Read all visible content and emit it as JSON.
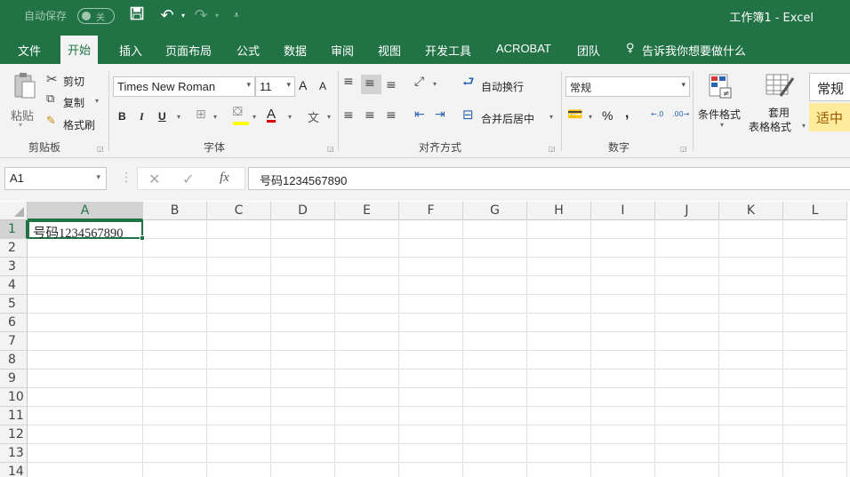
{
  "titlebar": {
    "autosave_label": "自动保存",
    "autosave_state": "关",
    "save_icon": "save-icon",
    "undo_icon": "undo-icon",
    "redo_icon": "redo-icon",
    "customize_icon": "customize-qat-icon",
    "title": "工作簿1 - Excel",
    "bg": "#217346"
  },
  "tabs": [
    "文件",
    "开始",
    "插入",
    "页面布局",
    "公式",
    "数据",
    "审阅",
    "视图",
    "开发工具",
    "ACROBAT",
    "团队"
  ],
  "active_tab": "开始",
  "tell_me": "告诉我你想要做什么",
  "ribbon": {
    "clipboard": {
      "paste": "粘贴",
      "cut": "剪切",
      "copy": "复制",
      "format_painter": "格式刷",
      "label": "剪贴板"
    },
    "font": {
      "name": "Times New Roman",
      "size": "11",
      "bold": "B",
      "italic": "I",
      "underline": "U",
      "label": "字体",
      "grow": "A",
      "shrink": "A",
      "font_color_letter": "A",
      "phonetic": "文"
    },
    "alignment": {
      "wrap": "自动换行",
      "merge": "合并后居中",
      "label": "对齐方式"
    },
    "number": {
      "format": "常规",
      "percent": "%",
      "comma": ",",
      "label": "数字"
    },
    "styles": {
      "conditional": "条件格式",
      "table_line1": "套用",
      "table_line2": "表格格式",
      "style_normal": "常规",
      "style_neutral": "适中"
    }
  },
  "formula_bar": {
    "name_box": "A1",
    "fx": "fx",
    "content": "号码1234567890"
  },
  "grid": {
    "columns": [
      "A",
      "B",
      "C",
      "D",
      "E",
      "F",
      "G",
      "H",
      "I",
      "J",
      "K",
      "L"
    ],
    "rows": [
      "1",
      "2",
      "3",
      "4",
      "5",
      "6",
      "7",
      "8",
      "9",
      "10",
      "11",
      "12",
      "13",
      "14"
    ],
    "selected_cell": "A1",
    "a1_value": "号码1234567890"
  }
}
